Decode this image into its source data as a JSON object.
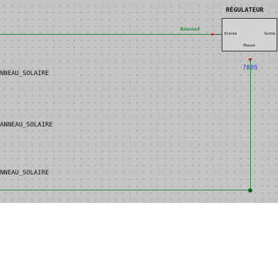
{
  "canvas": {
    "background": "#c4c4c4",
    "wire_color": "#1e8a32",
    "pin_marker_color": "#c42020",
    "reference_color": "#2a3fd0"
  },
  "net": {
    "name": "Réseau4"
  },
  "regulator": {
    "title": "RÉGULATEUR",
    "pin_input": "Entrée",
    "pin_output": "Sortie",
    "pin_ground": "Masse",
    "part_ref": "7805"
  },
  "panels": [
    {
      "label": "NNEAU_SOLAIRE"
    },
    {
      "label": "ANNEAU_SOLAIRE"
    },
    {
      "label": "NNEAU_SOLAIRE"
    }
  ]
}
